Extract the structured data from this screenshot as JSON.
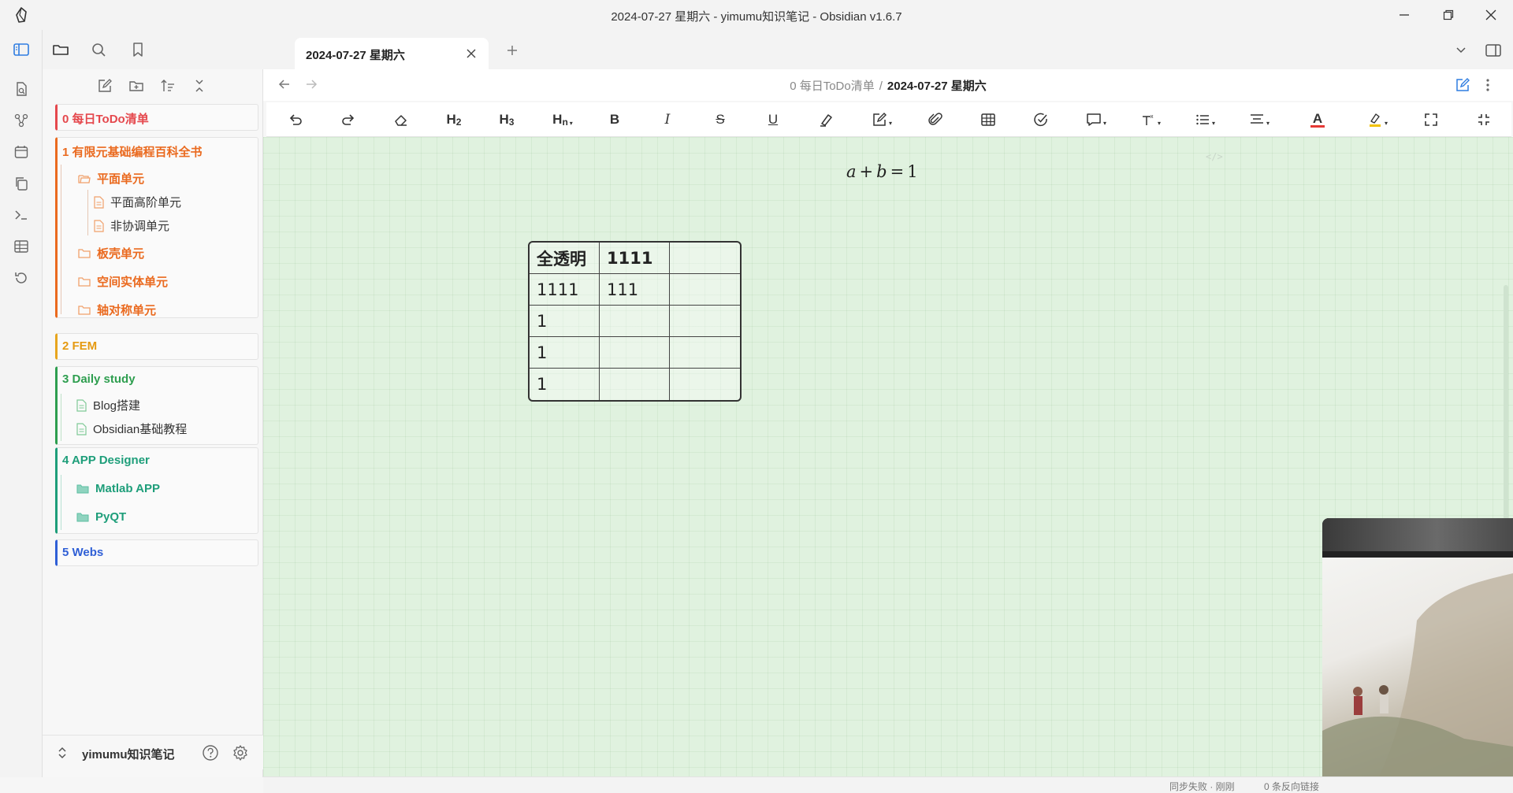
{
  "window": {
    "title": "2024-07-27 星期六 - yimumu知识笔记 - Obsidian v1.6.7",
    "controls": [
      "minimize",
      "restore",
      "close"
    ]
  },
  "ribbon": {
    "items": [
      "open-quick-switcher",
      "graph-view",
      "daily-notes",
      "templates",
      "command-palette",
      "tables",
      "file-recovery"
    ]
  },
  "sidebar": {
    "tabs": [
      "files",
      "search",
      "bookmarks"
    ],
    "actions": [
      "new-note",
      "new-folder",
      "sort",
      "collapse-all"
    ],
    "folders": [
      {
        "label": "0 每日ToDo清单",
        "color": "#e5484d"
      },
      {
        "label": "1 有限元基础编程百科全书",
        "color": "#ea6a1f",
        "children": [
          {
            "label": "平面单元",
            "type": "folder-open",
            "children": [
              {
                "label": "平面高阶单元",
                "type": "file"
              },
              {
                "label": "非协调单元",
                "type": "file"
              }
            ]
          },
          {
            "label": "板壳单元",
            "type": "folder"
          },
          {
            "label": "空间实体单元",
            "type": "folder"
          },
          {
            "label": "轴对称单元",
            "type": "folder"
          }
        ]
      },
      {
        "label": "2 FEM",
        "color": "#e7a51e"
      },
      {
        "label": "3 Daily study",
        "color": "#2e9e4f",
        "children": [
          {
            "label": "Blog搭建",
            "type": "file"
          },
          {
            "label": "Obsidian基础教程",
            "type": "file"
          }
        ]
      },
      {
        "label": "4 APP Designer",
        "color": "#1e9e7a",
        "children": [
          {
            "label": "Matlab APP",
            "type": "folder"
          },
          {
            "label": "PyQT",
            "type": "folder"
          }
        ]
      },
      {
        "label": "5 Webs",
        "color": "#2f5fd6"
      }
    ],
    "vault": {
      "name": "yimumu知识笔记"
    }
  },
  "tabbar": {
    "active_tab": "2024-07-27 星期六"
  },
  "view_header": {
    "breadcrumb_parent": "0 每日ToDo清单",
    "separator": "/",
    "breadcrumb_current": "2024-07-27 星期六"
  },
  "toolbar": {
    "buttons": [
      "undo",
      "redo",
      "clear-format",
      "H2",
      "H3",
      "Hn",
      "B",
      "I",
      "S",
      "U",
      "highlight-pen",
      "edit",
      "attach",
      "table",
      "task",
      "comment",
      "superscript",
      "list",
      "align",
      "font-color",
      "highlight",
      "fullscreen",
      "shrink"
    ],
    "font_color": "#e53935",
    "highlight_color": "#f2c200"
  },
  "editor": {
    "math": {
      "a": "a",
      "plus": "+",
      "b": "b",
      "eq": "=",
      "one": "1"
    },
    "code_marker": "</>",
    "table": {
      "header": [
        "全透明",
        "1111",
        ""
      ],
      "rows": [
        [
          "1111",
          "111",
          ""
        ],
        [
          "1",
          "",
          ""
        ],
        [
          "1",
          "",
          ""
        ],
        [
          "1",
          "",
          ""
        ]
      ]
    }
  },
  "statusbar": {
    "sync": "同步失败 · 刚刚",
    "backlinks": "0 条反向链接"
  }
}
